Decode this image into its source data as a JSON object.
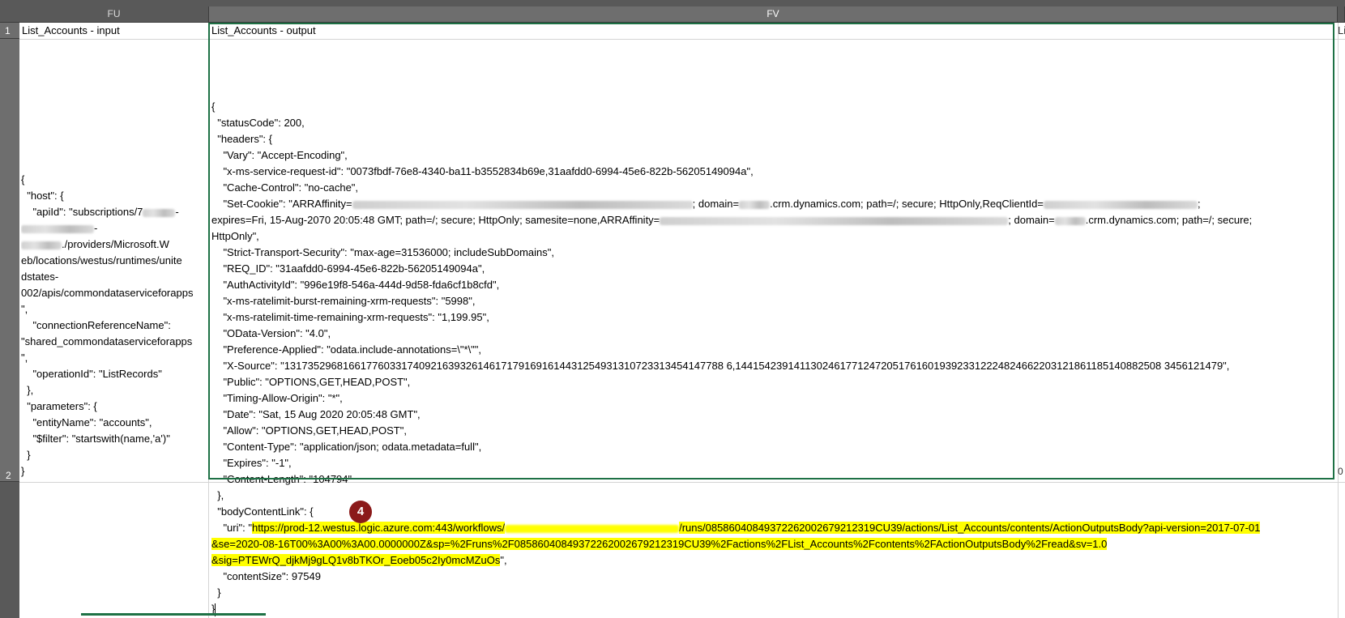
{
  "columns": {
    "fu": "FU",
    "fv": "FV"
  },
  "rows": {
    "r1": "1",
    "r2": "2"
  },
  "row1": {
    "fu": "List_Accounts - input",
    "fv": "List_Accounts - output",
    "next": "Li"
  },
  "fu_json": [
    "{",
    "  \"host\": {",
    "    \"apiId\": \"subscriptions/7",
    "",
    "./providers/Microsoft.W",
    "eb/locations/westus/runtimes/unite",
    "dstates-",
    "002/apis/commondataserviceforapps",
    "\",",
    "    \"connectionReferenceName\":",
    "\"shared_commondataserviceforapps",
    "\",",
    "    \"operationId\": \"ListRecords\"",
    "  },",
    "  \"parameters\": {",
    "    \"entityName\": \"accounts\",",
    "    \"$filter\": \"startswith(name,'a')\"",
    "  }",
    "}"
  ],
  "fv_json": [
    "{",
    "  \"statusCode\": 200,",
    "  \"headers\": {",
    "    \"Vary\": \"Accept-Encoding\",",
    "    \"x-ms-service-request-id\": \"0073fbdf-76e8-4340-ba11-b3552834b69e,31aafdd0-6994-45e6-822b-56205149094a\",",
    "    \"Cache-Control\": \"no-cache\",",
    "    \"Set-Cookie\": \"ARRAffinity=",
    "; domain=",
    ".crm.dynamics.com; path=/; secure; HttpOnly,ReqClientId=",
    ";",
    "expires=Fri, 15-Aug-2070 20:05:48 GMT; path=/; secure; HttpOnly; samesite=none,ARRAffinity=",
    "; domain=",
    ".crm.dynamics.com; path=/; secure;",
    "HttpOnly\",",
    "    \"Strict-Transport-Security\": \"max-age=31536000; includeSubDomains\",",
    "    \"REQ_ID\": \"31aafdd0-6994-45e6-822b-56205149094a\",",
    "    \"AuthActivityId\": \"996e19f8-546a-444d-9d58-fda6cf1b8cfd\",",
    "    \"x-ms-ratelimit-burst-remaining-xrm-requests\": \"5998\",",
    "    \"x-ms-ratelimit-time-remaining-xrm-requests\": \"1,199.95\",",
    "    \"OData-Version\": \"4.0\",",
    "    \"Preference-Applied\": \"odata.include-annotations=\\\"*\\\"\",",
    "    \"X-Source\": \"131735296816617760331740921639326146171791691614431254931310723313454147788 6,1441542391411302461771247205176160193923312224824662203121861185140882508 3456121479\",",
    "    \"Public\": \"OPTIONS,GET,HEAD,POST\",",
    "    \"Timing-Allow-Origin\": \"*\",",
    "    \"Date\": \"Sat, 15 Aug 2020 20:05:48 GMT\",",
    "    \"Allow\": \"OPTIONS,GET,HEAD,POST\",",
    "    \"Content-Type\": \"application/json; odata.metadata=full\",",
    "    \"Expires\": \"-1\",",
    "    \"Content-Length\": \"104794\"",
    "  },",
    "  \"bodyContentLink\": {",
    "    \"uri\": \"",
    "https://prod-12.westus.logic.azure.com:443/workflows/",
    "/runs/08586040849372262002679212319CU39/actions/List_Accounts/contents/ActionOutputsBody?api-version=2017-07-01",
    "&se=2020-08-16T00%3A00%3A00.0000000Z&sp=%2Fruns%2F08586040849372262002679212319CU39%2Factions%2FList_Accounts%2Fcontents%2FActionOutputsBody%2Fread&sv=1.0",
    "&sig=PTEWrQ_djkMj9gLQ1v8bTKOr_Eoeb05c2Iy0mcMZuOs",
    "\",",
    "    \"contentSize\": 97549",
    "  }",
    "}"
  ],
  "annotation": {
    "badge_number": "4",
    "badge_color": "#8b1a1a",
    "highlight_color": "#ffff00"
  },
  "right_edge_value": "0"
}
